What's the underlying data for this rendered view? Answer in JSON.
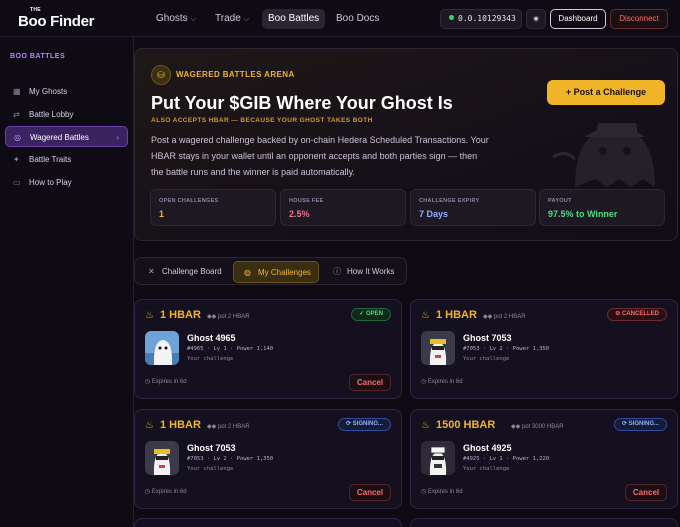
{
  "brand": {
    "small": "THE",
    "name": "Boo Finder"
  },
  "nav": [
    {
      "label": "Ghosts",
      "chev": "⌵"
    },
    {
      "label": "Trade",
      "chev": "⌵"
    },
    {
      "label": "Boo Battles"
    },
    {
      "label": "Boo Docs"
    }
  ],
  "wallet": {
    "address": "0.0.10129343"
  },
  "buttons": {
    "dashboard": "Dashboard",
    "disconnect": "Disconnect"
  },
  "sidebar": {
    "heading": "BOO BATTLES",
    "items": [
      {
        "label": "My Ghosts",
        "icon": "▦"
      },
      {
        "label": "Battle Lobby",
        "icon": "⇄"
      },
      {
        "label": "Wagered Battles",
        "icon": "◎",
        "active": true
      },
      {
        "label": "Battle Traits",
        "icon": "✦"
      },
      {
        "label": "How to Play",
        "icon": "▭"
      }
    ]
  },
  "hero": {
    "kicker": "WAGERED BATTLES ARENA",
    "title": "Put Your $GIB Where Your Ghost Is",
    "subtitle": "ALSO ACCEPTS HBAR — BECAUSE YOUR GHOST TAKES BOTH",
    "description": "Post a wagered challenge backed by on-chain Hedera Scheduled Transactions. Your HBAR stays in your wallet until an opponent accepts and both parties sign — then the battle runs and the winner is paid automatically.",
    "post_button": "Post a Challenge",
    "stats": [
      {
        "label": "OPEN CHALLENGES",
        "value": "1",
        "color": "#f0b429"
      },
      {
        "label": "HOUSE FEE",
        "value": "2.5%",
        "color": "#ff6b8a"
      },
      {
        "label": "CHALLENGE EXPIRY",
        "value": "7 Days",
        "color": "#8fb0ff"
      },
      {
        "label": "PAYOUT",
        "value": "97.5% to Winner",
        "color": "#4ade80"
      }
    ]
  },
  "tabs": [
    {
      "label": "Challenge Board",
      "icon": "✕"
    },
    {
      "label": "My Challenges",
      "icon": "◍",
      "active": true
    },
    {
      "label": "How It Works",
      "icon": "ⓘ"
    }
  ],
  "cards": [
    {
      "amount": "1 HBAR",
      "pot": "◆◆ pot 2 HBAR",
      "status": "✓ OPEN",
      "status_type": "open",
      "ghost": "Ghost 4965",
      "meta": "#4965 · Lv 1 · Power 1,140",
      "note": "Your challenge",
      "expires": "◷ Expires in 6d",
      "action": "Cancel"
    },
    {
      "amount": "1 HBAR",
      "pot": "◆◆ pot 2 HBAR",
      "status": "⊘ CANCELLED",
      "status_type": "cancel",
      "ghost": "Ghost 7053",
      "meta": "#7053 · Lv 2 · Power 1,350",
      "note": "Your challenge",
      "expires": "◷ Expires in 6d",
      "action": ""
    },
    {
      "amount": "1 HBAR",
      "pot": "◆◆ pot 2 HBAR",
      "status": "⟳ SIGNING...",
      "status_type": "sign",
      "ghost": "Ghost 7053",
      "meta": "#7053 · Lv 2 · Power 1,350",
      "note": "Your challenge",
      "expires": "◷ Expires in 6d",
      "action": "Cancel"
    },
    {
      "amount": "1500 HBAR",
      "pot": "◆◆ pot 3000 HBAR",
      "status": "⟳ SIGNING...",
      "status_type": "sign",
      "ghost": "Ghost 4925",
      "meta": "#4925 · Lv 1 · Power 1,220",
      "note": "Your challenge",
      "expires": "◷ Expires in 6d",
      "action": "Cancel"
    }
  ]
}
